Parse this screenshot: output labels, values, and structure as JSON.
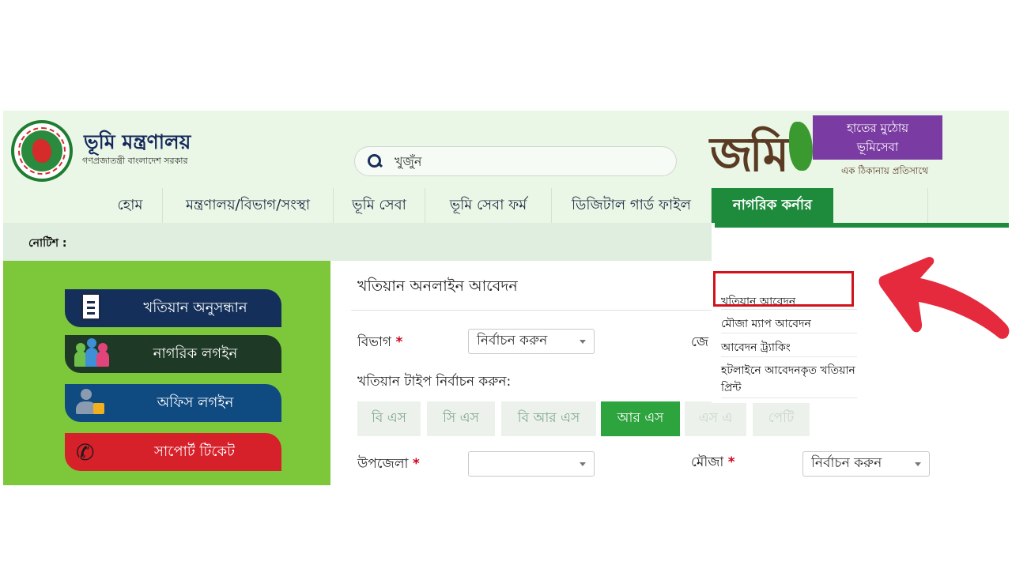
{
  "header": {
    "ministry_title": "ভূমি মন্ত্রণালয়",
    "ministry_subtitle": "গণপ্রজাতন্ত্রী বাংলাদেশ সরকার",
    "search_placeholder": "খুজুঁন",
    "brand_logo": "জমি",
    "tagline_line1": "হাতের মুঠোয়",
    "tagline_line2": "ভূমিসেবা",
    "tagline_small": "এক ঠিকানায় প্রতিসাথে"
  },
  "nav": {
    "items": [
      {
        "label": "হোম"
      },
      {
        "label": "মন্ত্রণালয়/বিভাগ/সংস্থা"
      },
      {
        "label": "ভূমি সেবা"
      },
      {
        "label": "ভূমি সেবা ফর্ম"
      },
      {
        "label": "ডিজিটাল গার্ড ফাইল"
      },
      {
        "label": "নাগরিক কর্নার"
      }
    ],
    "active": "নাগরিক কর্নার"
  },
  "notice": {
    "label": "নোটিশ :"
  },
  "sidebar": {
    "buttons": [
      {
        "label": "খতিয়ান অনুসন্ধান",
        "icon": "clipboard-icon",
        "color": "#14305a"
      },
      {
        "label": "নাগরিক লগইন",
        "icon": "people-icon",
        "color": "#1e3a26"
      },
      {
        "label": "অফিস লগইন",
        "icon": "user-lock-icon",
        "color": "#0f4a80"
      },
      {
        "label": "সাপোর্ট টিকেট",
        "icon": "phone-icon",
        "color": "#d6202a"
      }
    ]
  },
  "form": {
    "title": "খতিয়ান অনলাইন আবেদন",
    "division_label": "বিভাগ",
    "division_value": "নির্বাচন করুন",
    "district_label_partial": "জে",
    "khatian_type_label": "খতিয়ান টাইপ নির্বাচন করুন:",
    "types": [
      "বি এস",
      "সি এস",
      "বি আর এস",
      "আর এস",
      "এস এ",
      "পেটি"
    ],
    "active_type": "আর এস",
    "upazila_label": "উপজেলা",
    "upazila_value": "",
    "mouza_label": "মৌজা",
    "mouza_value": "নির্বাচন করুন"
  },
  "dropdown": {
    "items": [
      "খতিয়ান আবেদন",
      "মৌজা ম্যাপ আবেদন",
      "আবেদন ট্র্যাকিং",
      "হটলাইনে আবেদনকৃত খতিয়ান প্রিন্ট"
    ],
    "highlighted": "খতিয়ান আবেদন"
  },
  "colors": {
    "header_bg": "#eaf6e6",
    "active_nav": "#1e8a3c",
    "sidebar_bg": "#7dc73a",
    "highlight": "#d1121a",
    "arrow": "#e52a3d"
  }
}
